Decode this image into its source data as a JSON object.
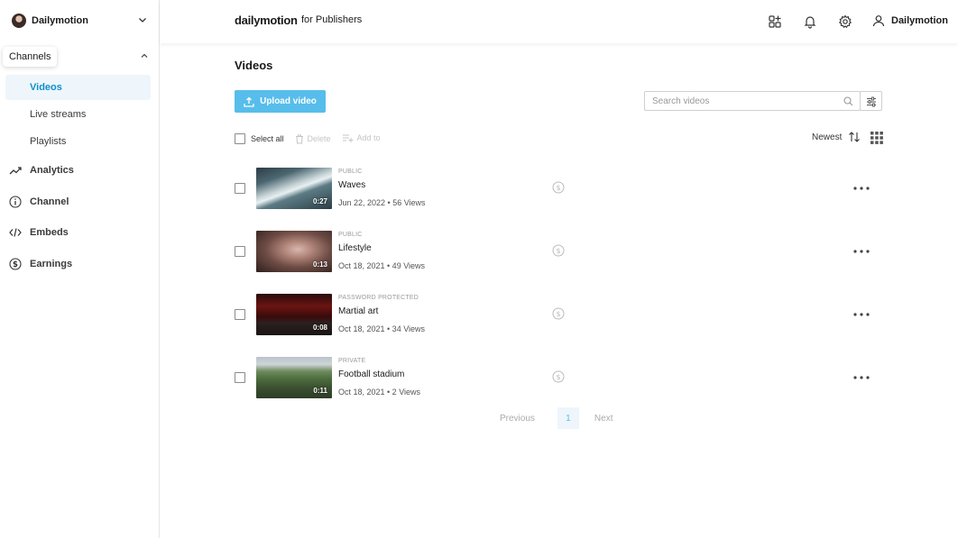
{
  "sidebar": {
    "account_name": "Dailymotion",
    "section_label": "Channels",
    "sub_items": [
      {
        "label": "Videos"
      },
      {
        "label": "Live streams"
      },
      {
        "label": "Playlists"
      }
    ],
    "main_items": [
      {
        "label": "Analytics",
        "icon": "analytics-icon"
      },
      {
        "label": "Channel",
        "icon": "info-icon"
      },
      {
        "label": "Embeds",
        "icon": "code-icon"
      },
      {
        "label": "Earnings",
        "icon": "dollar-icon"
      }
    ]
  },
  "header": {
    "logo": "dailymotion",
    "logo_suffix": "for Publishers",
    "user_name": "Dailymotion"
  },
  "main": {
    "title": "Videos",
    "upload_label": "Upload video",
    "search_placeholder": "Search videos",
    "toolbar": {
      "select_all": "Select all",
      "delete": "Delete",
      "add_to": "Add to"
    },
    "sort_label": "Newest"
  },
  "videos": [
    {
      "visibility": "PUBLIC",
      "title": "Waves",
      "meta": "Jun 22, 2022 • 56 Views",
      "duration": "0:27"
    },
    {
      "visibility": "PUBLIC",
      "title": "Lifestyle",
      "meta": "Oct 18, 2021 • 49 Views",
      "duration": "0:13"
    },
    {
      "visibility": "PASSWORD PROTECTED",
      "title": "Martial art",
      "meta": "Oct 18, 2021 • 34 Views",
      "duration": "0:08"
    },
    {
      "visibility": "PRIVATE",
      "title": "Football stadium",
      "meta": "Oct 18, 2021 • 2 Views",
      "duration": "0:11"
    }
  ],
  "pagination": {
    "previous": "Previous",
    "current": "1",
    "next": "Next"
  },
  "colors": {
    "accent": "#57bdeb",
    "active_nav": "#0e8fcc"
  }
}
